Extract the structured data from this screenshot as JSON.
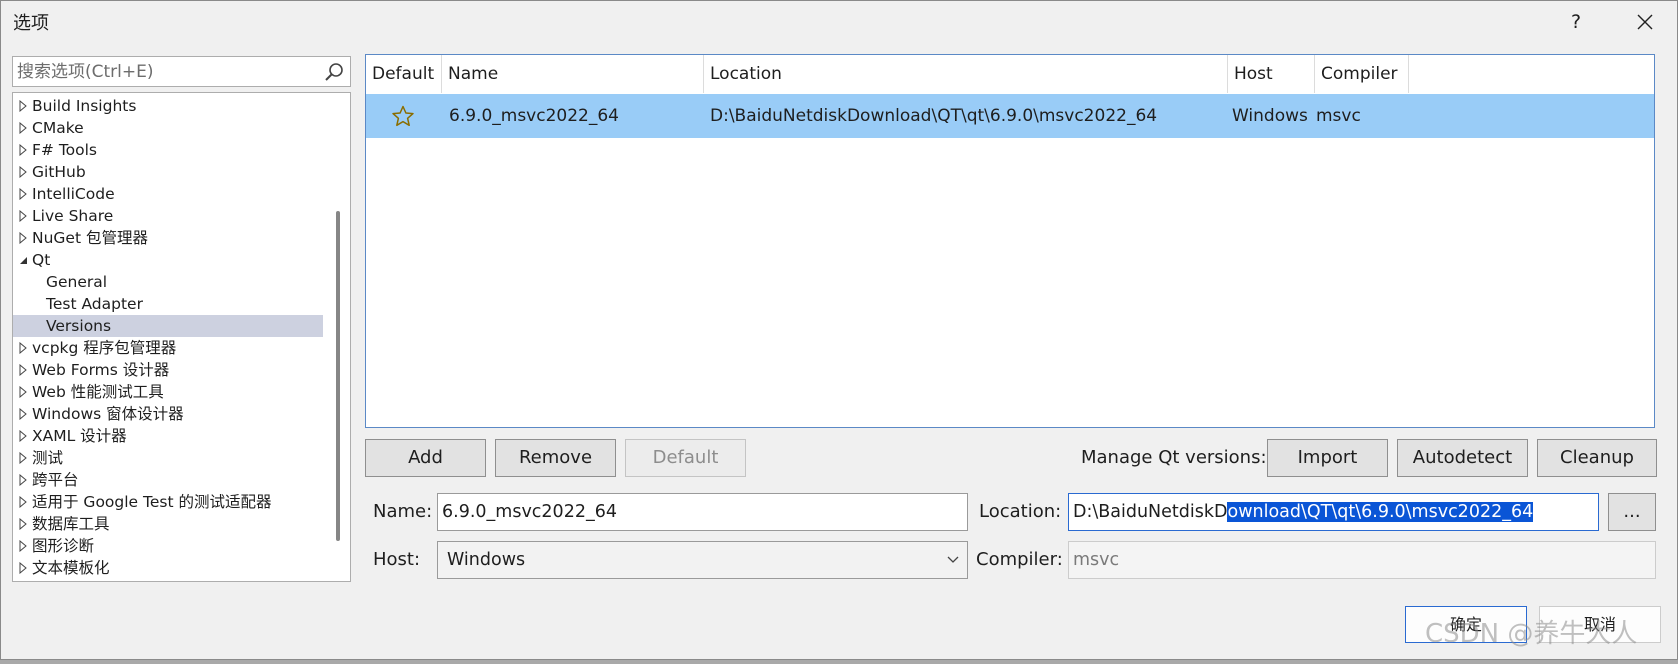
{
  "window": {
    "title": "选项",
    "help_label": "?"
  },
  "search": {
    "placeholder": "搜索选项(Ctrl+E)"
  },
  "tree": {
    "items": [
      {
        "label": "Build Insights",
        "expanded": false
      },
      {
        "label": "CMake",
        "expanded": false
      },
      {
        "label": "F# Tools",
        "expanded": false
      },
      {
        "label": "GitHub",
        "expanded": false
      },
      {
        "label": "IntelliCode",
        "expanded": false
      },
      {
        "label": "Live Share",
        "expanded": false
      },
      {
        "label": "NuGet 包管理器",
        "expanded": false
      },
      {
        "label": "Qt",
        "expanded": true
      },
      {
        "label": "General",
        "child": true
      },
      {
        "label": "Test Adapter",
        "child": true
      },
      {
        "label": "Versions",
        "child": true,
        "selected": true
      },
      {
        "label": "vcpkg 程序包管理器",
        "expanded": false
      },
      {
        "label": "Web Forms 设计器",
        "expanded": false
      },
      {
        "label": "Web 性能测试工具",
        "expanded": false
      },
      {
        "label": "Windows 窗体设计器",
        "expanded": false
      },
      {
        "label": "XAML 设计器",
        "expanded": false
      },
      {
        "label": "测试",
        "expanded": false
      },
      {
        "label": "跨平台",
        "expanded": false
      },
      {
        "label": "适用于 Google Test 的测试适配器",
        "expanded": false
      },
      {
        "label": "数据库工具",
        "expanded": false
      },
      {
        "label": "图形诊断",
        "expanded": false
      },
      {
        "label": "文本模板化",
        "expanded": false
      }
    ]
  },
  "versions_table": {
    "columns": [
      "Default",
      "Name",
      "Location",
      "Host",
      "Compiler"
    ],
    "rows": [
      {
        "default_icon": "star-outline-icon",
        "name": "6.9.0_msvc2022_64",
        "location": "D:\\BaiduNetdiskDownload\\QT\\qt\\6.9.0\\msvc2022_64",
        "host": "Windows",
        "compiler": "msvc"
      }
    ]
  },
  "buttons": {
    "add": "Add",
    "remove": "Remove",
    "default": "Default",
    "manage_label": "Manage Qt versions:",
    "import": "Import",
    "autodetect": "Autodetect",
    "cleanup": "Cleanup",
    "browse": "...",
    "ok": "确定",
    "cancel": "取消"
  },
  "form": {
    "name_label": "Name:",
    "name_value": "6.9.0_msvc2022_64",
    "location_label": "Location:",
    "location_prefix": "D:\\BaiduNetdiskD",
    "location_selected": "ownload\\QT\\qt\\6.9.0\\msvc2022_64",
    "host_label": "Host:",
    "host_value": "Windows",
    "compiler_label": "Compiler:",
    "compiler_value": "msvc"
  },
  "watermark": "CSDN @养牛大人",
  "colors": {
    "selection": "#99ccf7",
    "tree_selection": "#cdd1e0",
    "text_selection": "#0a55d6",
    "accent": "#2a6ad1"
  }
}
